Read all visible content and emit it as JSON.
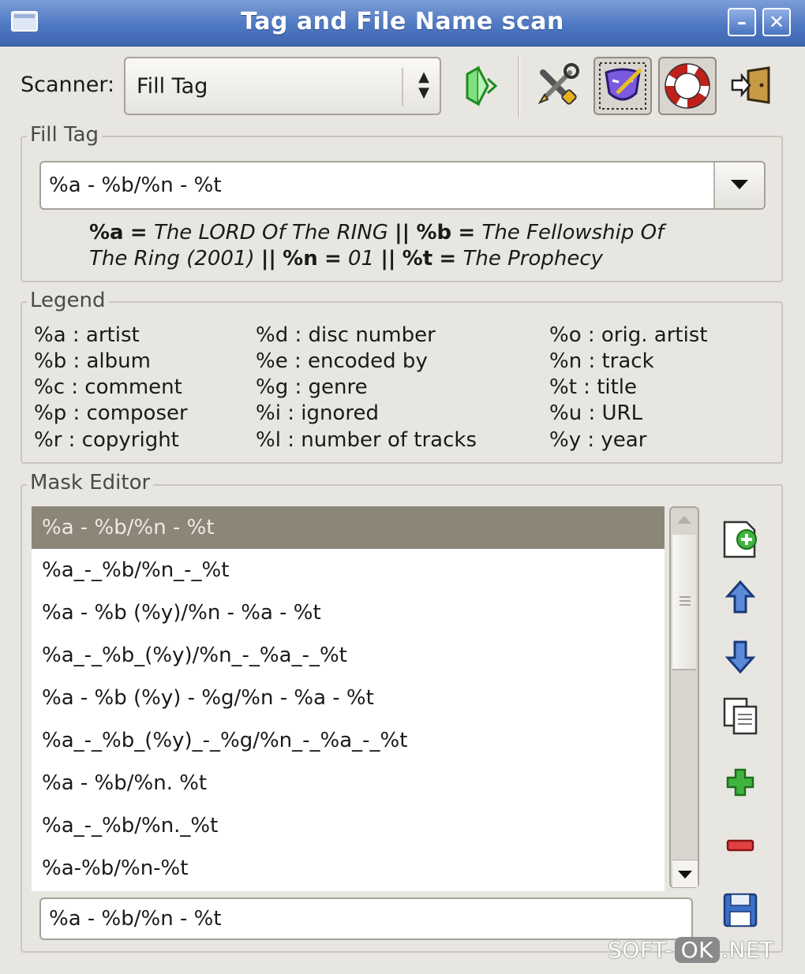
{
  "window": {
    "title": "Tag and File Name scan"
  },
  "toolbar": {
    "scanner_label": "Scanner:",
    "scanner_value": "Fill Tag",
    "icons": [
      "scan-icon",
      "settings-icon",
      "mask-editor-icon",
      "help-icon",
      "exit-icon"
    ]
  },
  "fill_tag": {
    "group_title": "Fill Tag",
    "mask_value": "%a - %b/%n - %t",
    "preview_line1": [
      {
        "code": "%a",
        "eq": " = ",
        "value": "The LORD Of The RING"
      },
      {
        "sep": " || "
      },
      {
        "code": "%b",
        "eq": " = ",
        "value": "The Fellowship Of"
      }
    ],
    "preview_line1_text": {
      "a_code": "%a",
      "a_value": "The LORD Of The RING",
      "b_code": "%b",
      "b_value": "The Fellowship Of"
    },
    "preview_line2_text": {
      "b_value_cont": "The Ring (2001)",
      "n_code": "%n",
      "n_value": "01",
      "t_code": "%t",
      "t_value": "The Prophecy"
    },
    "equals": "=",
    "separator": "||"
  },
  "legend": {
    "group_title": "Legend",
    "col1": [
      "%a : artist",
      "%b : album",
      "%c : comment",
      "%p : composer",
      "%r : copyright"
    ],
    "col2": [
      "%d : disc number",
      "%e : encoded by",
      "%g : genre",
      "%i : ignored",
      "%l : number of tracks"
    ],
    "col3": [
      "%o : orig. artist",
      "%n : track",
      "%t : title",
      "%u : URL",
      "%y : year"
    ]
  },
  "mask_editor": {
    "group_title": "Mask Editor",
    "items": [
      "%a - %b/%n - %t",
      "%a_-_%b/%n_-_%t",
      "%a - %b (%y)/%n - %a - %t",
      "%a_-_%b_(%y)/%n_-_%a_-_%t",
      "%a - %b (%y) - %g/%n - %a - %t",
      "%a_-_%b_(%y)_-_%g/%n_-_%a_-_%t",
      "%a - %b/%n. %t",
      "%a_-_%b/%n._%t",
      "%a-%b/%n-%t"
    ],
    "selected_index": 0,
    "edit_value": "%a - %b/%n - %t",
    "side_icons": [
      "new-mask-icon",
      "move-up-icon",
      "move-down-icon",
      "duplicate-icon",
      "add-icon",
      "remove-icon",
      "save-icon"
    ]
  },
  "watermark": {
    "left": "SOFT-",
    "mid": "OK",
    "right": ".NET"
  }
}
